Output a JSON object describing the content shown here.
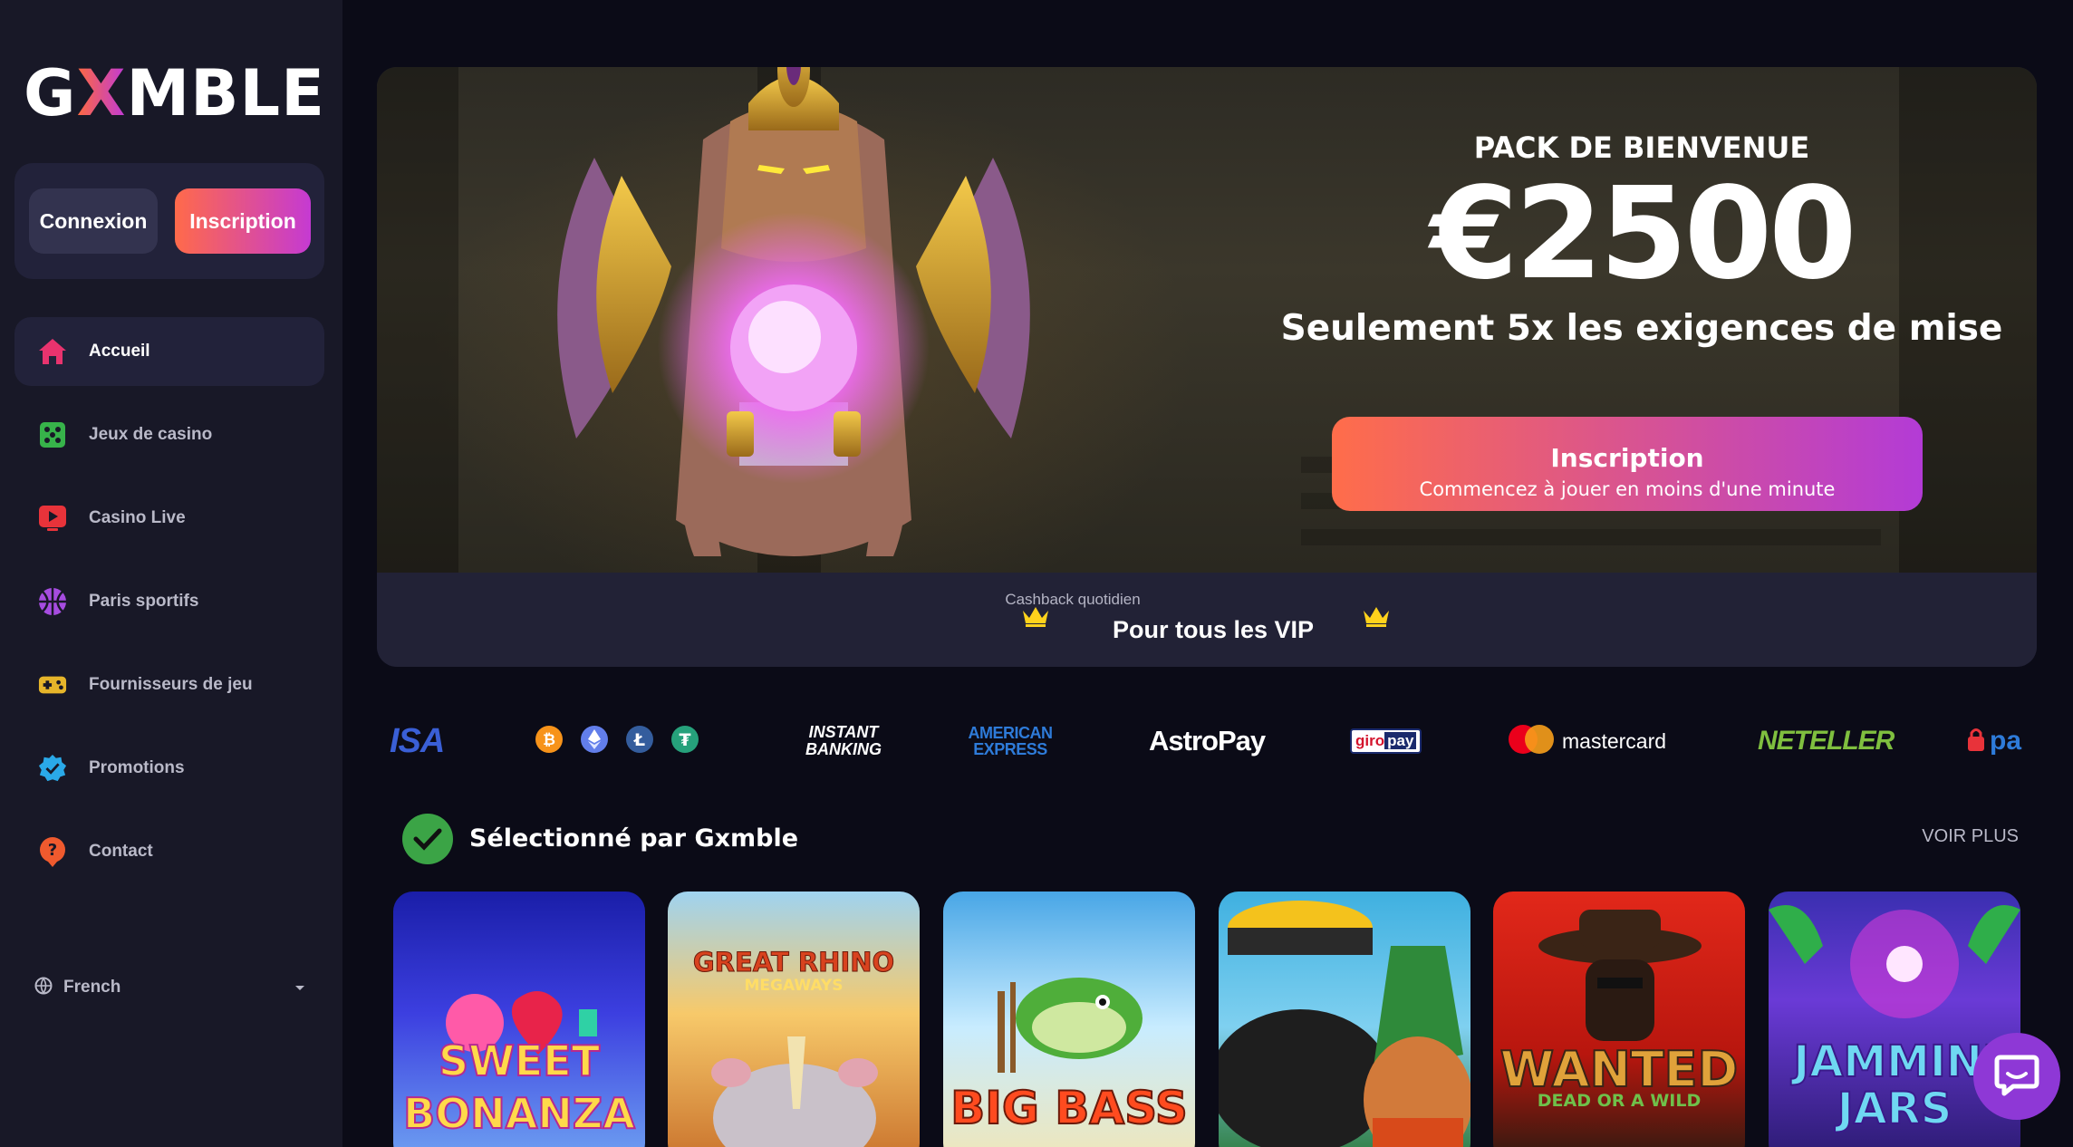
{
  "brand": {
    "name_part1": "G",
    "name_x": "X",
    "name_part2": "MBLE"
  },
  "auth": {
    "login_label": "Connexion",
    "signup_label": "Inscription"
  },
  "sidebar": {
    "items": [
      {
        "label": "Accueil",
        "icon": "home-icon",
        "color": "#e8336e",
        "active": true
      },
      {
        "label": "Jeux de casino",
        "icon": "dice-icon",
        "color": "#37b34a",
        "active": false
      },
      {
        "label": "Casino Live",
        "icon": "live-play-icon",
        "color": "#e8333a",
        "active": false
      },
      {
        "label": "Paris sportifs",
        "icon": "basketball-icon",
        "color": "#a64ce0",
        "active": false
      },
      {
        "label": "Fournisseurs de jeu",
        "icon": "gamepad-icon",
        "color": "#e6b52a",
        "active": false
      },
      {
        "label": "Promotions",
        "icon": "promo-badge-icon",
        "color": "#2aa9e8",
        "active": false
      },
      {
        "label": "Contact",
        "icon": "help-icon",
        "color": "#ef5a2e",
        "active": false
      }
    ],
    "language": {
      "label": "French",
      "icon": "globe-icon"
    }
  },
  "hero": {
    "kicker": "PACK DE BIENVENUE",
    "amount": "€2500",
    "subtitle": "Seulement 5x les exigences de mise",
    "cta_title": "Inscription",
    "cta_subtitle": "Commencez à jouer en moins d'une minute",
    "cashback_small": "Cashback quotidien",
    "cashback_big": "Pour tous les VIP"
  },
  "payments": [
    "ISA",
    "INSTANT BANKING",
    "AMERICAN EXPRESS",
    "AstroPay",
    "giro",
    "pay",
    "mastercard",
    "NETELLER",
    "pa"
  ],
  "section": {
    "title": "Sélectionné par Gxmble",
    "see_more": "VOIR PLUS"
  },
  "games": [
    {
      "title_line1": "SWEET",
      "title_line2": "BONANZA"
    },
    {
      "title_line1": "GREAT RHINO",
      "title_line2": "MEGAWAYS"
    },
    {
      "title_line1": "BIG BASS",
      "title_line2": ""
    },
    {
      "title_line1": "",
      "title_line2": ""
    },
    {
      "title_line1": "WANTED",
      "title_line2": "DEAD OR A WILD"
    },
    {
      "title_line1": "JAMMIN'",
      "title_line2": "JARS"
    }
  ],
  "colors": {
    "background": "#0b0b17",
    "sidebar": "#181827",
    "accent_start": "#ff6a4a",
    "accent_end": "#c53ad2"
  }
}
